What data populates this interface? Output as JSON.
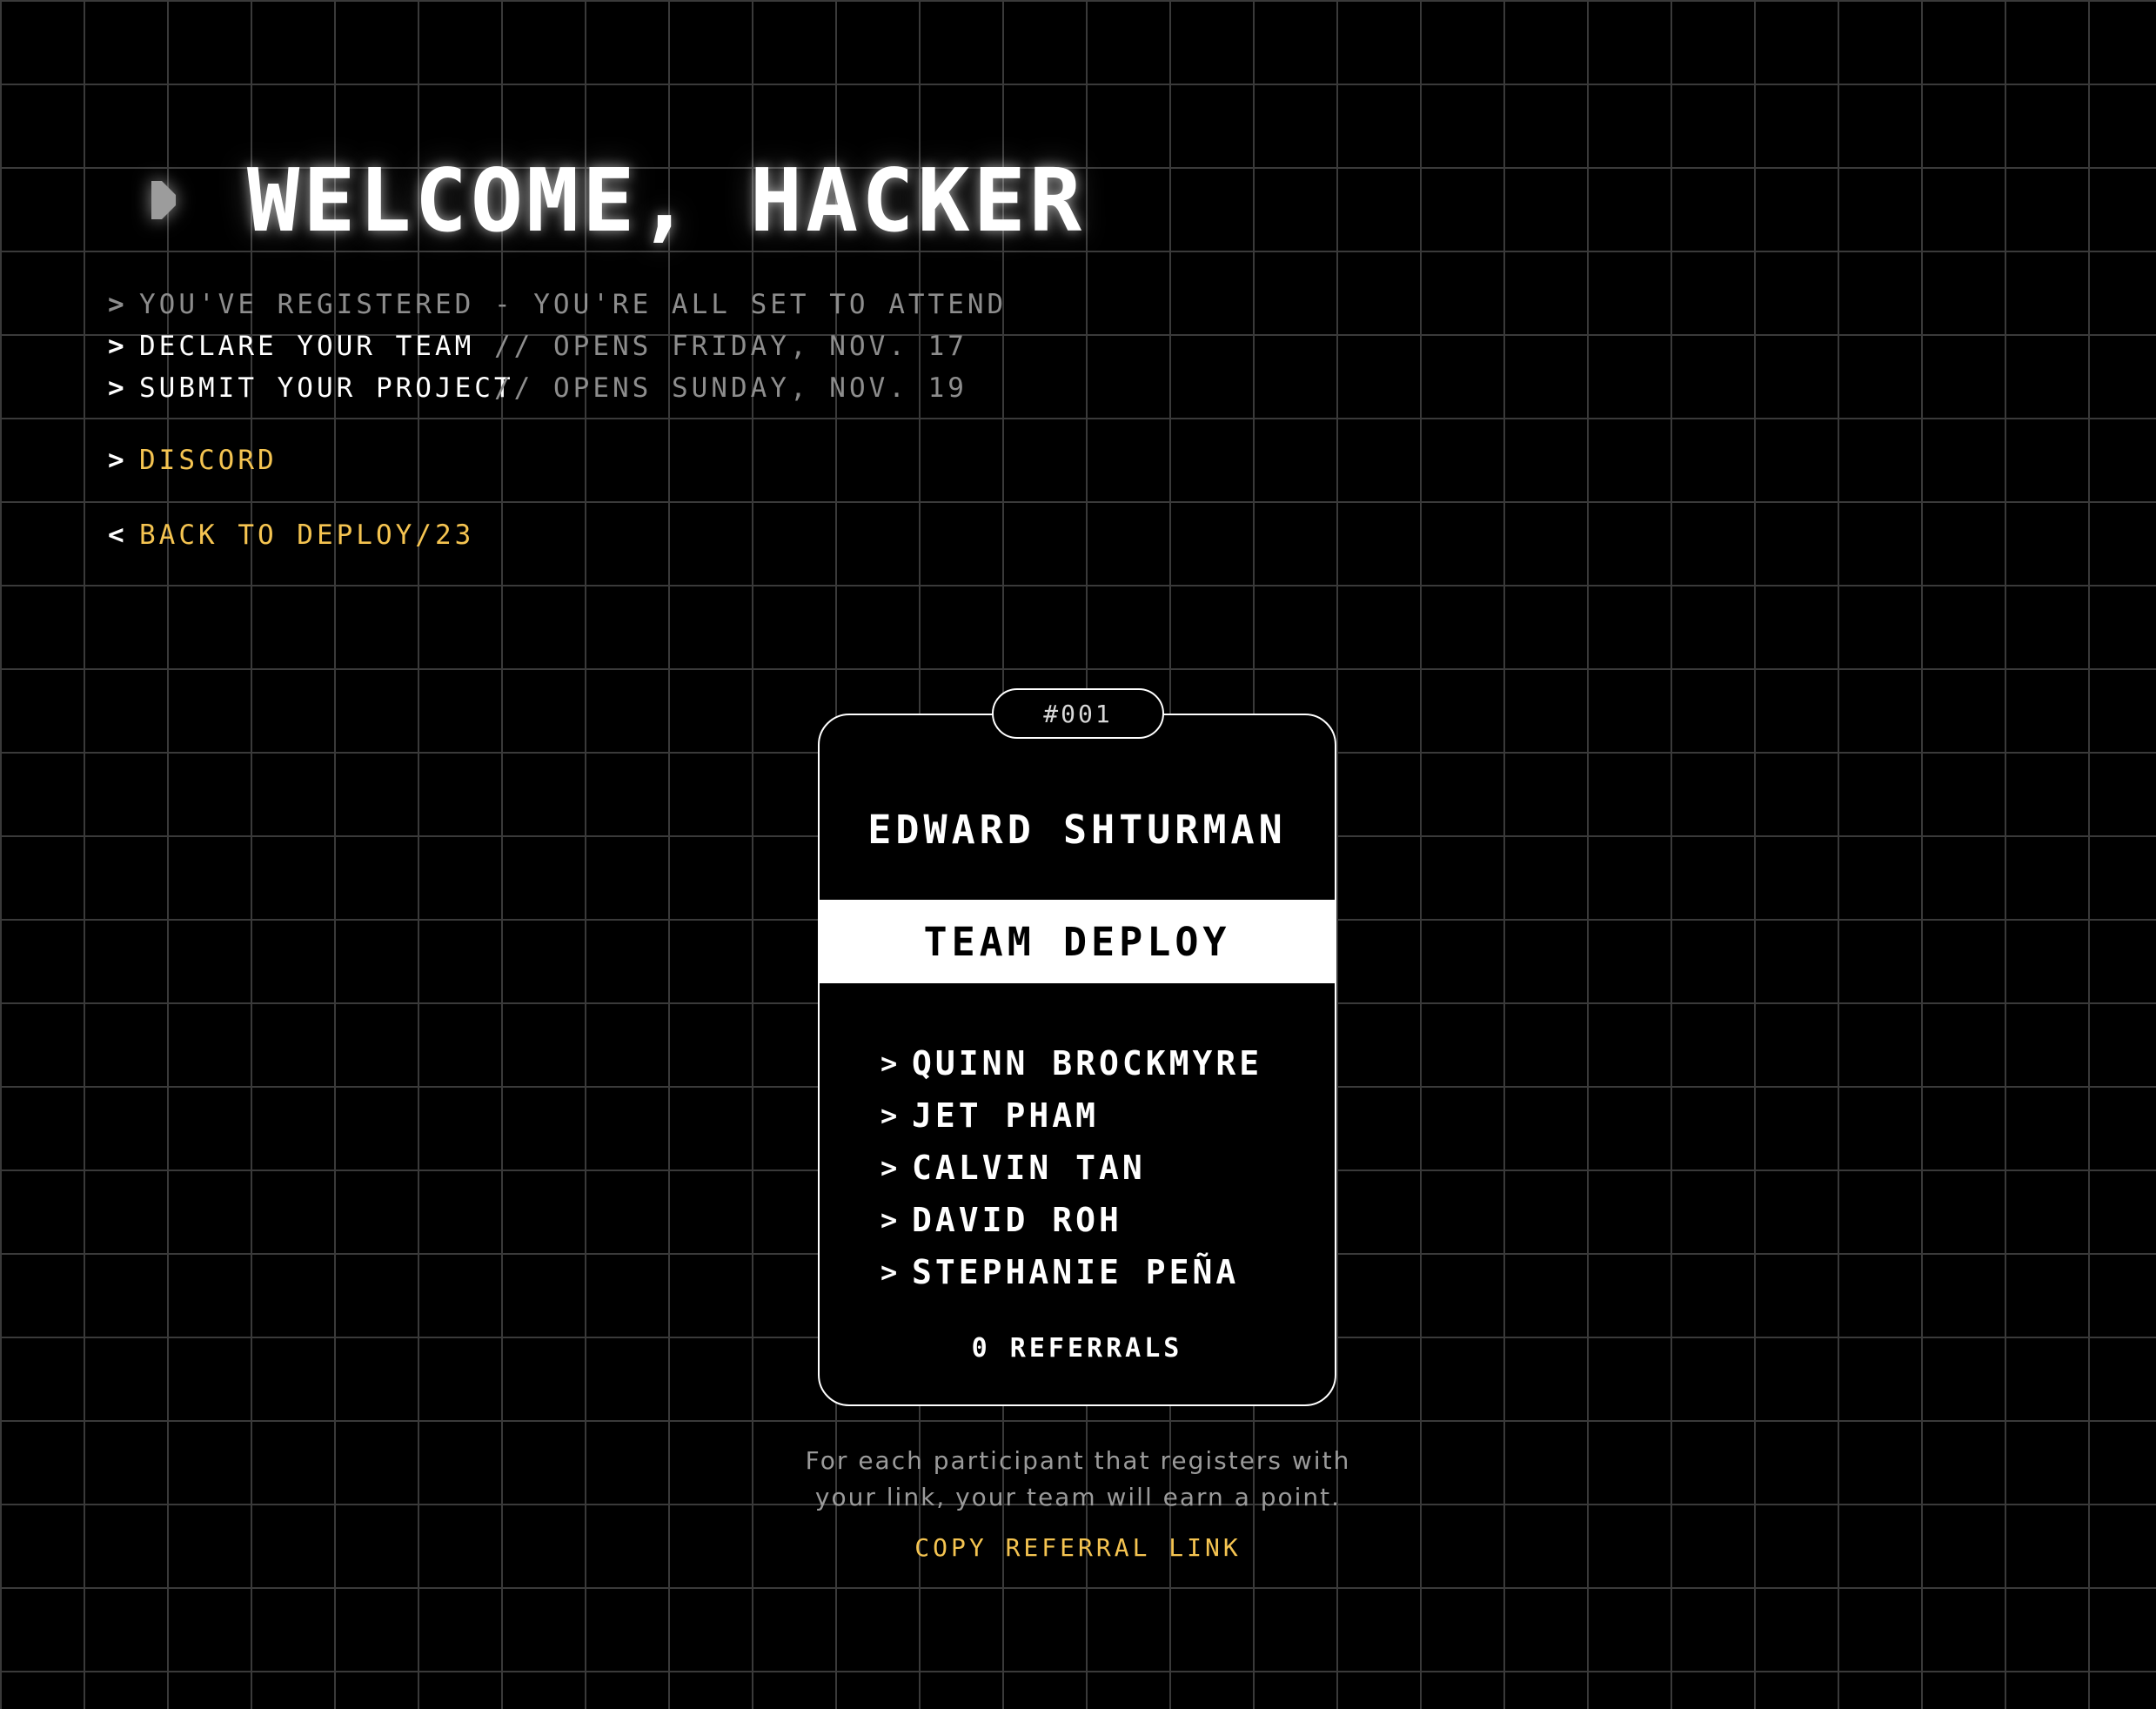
{
  "header": {
    "title": "WELCOME, HACKER",
    "icon": "play-icon"
  },
  "status": {
    "registered": "YOU'VE REGISTERED - YOU'RE ALL SET TO ATTEND",
    "declare_team": "DECLARE YOUR TEAM",
    "declare_team_note": "// OPENS FRIDAY, NOV. 17",
    "submit_project": "SUBMIT YOUR PROJECT",
    "submit_project_note": "// OPENS SUNDAY, NOV. 19"
  },
  "links": {
    "discord": "DISCORD",
    "back": "BACK TO DEPLOY/23"
  },
  "card": {
    "badge": "#001",
    "name": "EDWARD SHTURMAN",
    "team": "TEAM DEPLOY",
    "members": [
      "QUINN BROCKMYRE",
      "JET PHAM",
      "CALVIN TAN",
      "DAVID ROH",
      "STEPHANIE PEÑA"
    ],
    "referrals": "0 REFERRALS"
  },
  "footer": {
    "info_line1": "For each participant that registers with",
    "info_line2": "your link, your team will earn a point.",
    "copy_link": "COPY REFERRAL LINK"
  },
  "colors": {
    "background": "#000000",
    "grid": "#3a3a3a",
    "accent": "#f5c451",
    "dim_text": "#8d8d8d",
    "text": "#ffffff"
  },
  "glyphs": {
    "caret_right": ">",
    "caret_left": "<"
  }
}
